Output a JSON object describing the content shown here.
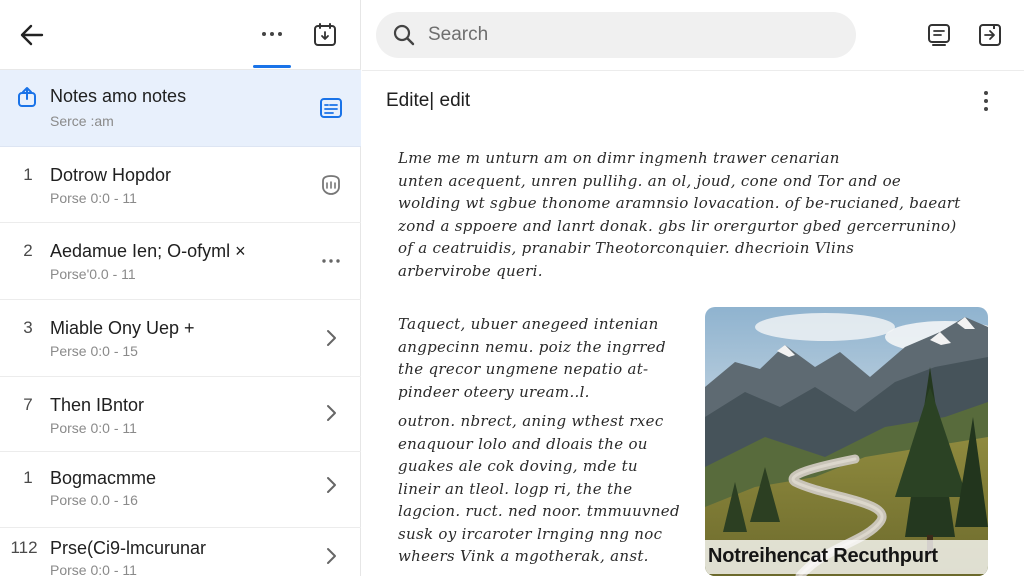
{
  "left_panel": {
    "tabs_indicator": "active",
    "selected": {
      "title": "Notes amo notes",
      "subtitle": "Serce :am"
    },
    "items": [
      {
        "num": "1",
        "title": "Dotrow Hopdor",
        "subtitle": "Porse 0:0 - 11",
        "trail_icon": "mask-icon"
      },
      {
        "num": "2",
        "title": "Aedamue Ien; O-ofyml ×",
        "subtitle": "Porse'0.0 - 11",
        "trail_icon": "ellipsis-icon"
      },
      {
        "num": "3",
        "title": "Miable Ony Uep +",
        "subtitle": "Perse 0:0 - 15",
        "trail_icon": "chevron-right-icon"
      },
      {
        "num": "7",
        "title": "Then IBntor",
        "subtitle": "Porse 0:0 - 11",
        "trail_icon": "chevron-right-icon"
      },
      {
        "num": "1",
        "title": "Bogmacmme",
        "subtitle": "Porse 0.0 - 16",
        "trail_icon": "chevron-right-icon"
      },
      {
        "num": "112",
        "title": "Prse(Ci9-lmcurunar",
        "subtitle": "Porse 0:0 - 11",
        "trail_icon": "chevron-right-icon"
      }
    ]
  },
  "search": {
    "placeholder": "Search"
  },
  "editor": {
    "title": "Edite| edit",
    "paragraph1": [
      "Lme me m unturn am on dimr ingmenh trawer cenarian",
      "unten acequent, unren pullihg. an ol, joud, cone ond Tor and  oe",
      "wolding wt sgbue thonome aramnsio lovacation. of be-rucianed, baeart",
      "zond a sppoere and lanrt donak. gbs lir orergurtor gbed gercerrunino)",
      "of a ceatruidis, pranabir Theotorconquier. dhecrioin Vlins",
      "arbervirobe queri."
    ],
    "paragraph2": [
      "Taquect, ubuer anegeed intenian",
      "angpecinn nemu. poiz the ingrred",
      "the qrecor ungmene nepatio at-",
      "pindeer oteery uream..l."
    ],
    "paragraph3": [
      "outron. nbrect, aning wthest rxec",
      "enaquour lolo and dloais the ou",
      "guakes ale cok doving, mde tu",
      "lineir an tleol. logp ri, the the",
      "lagcion. ruct. ned noor. tmmuuvned",
      "susk oy ircaroter lrnging nng noc",
      "wheers Vink a mgotherak, anst."
    ],
    "image_caption": "Notreihencat Recuthpurt"
  }
}
